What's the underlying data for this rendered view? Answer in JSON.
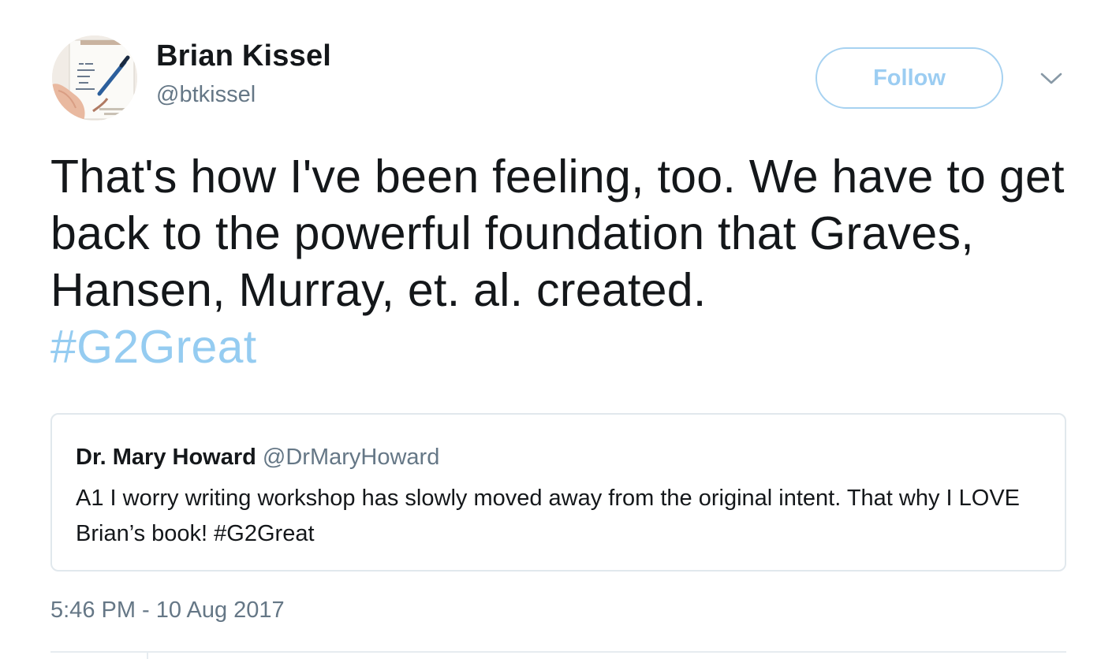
{
  "author": {
    "name": "Brian Kissel",
    "handle": "@btkissel",
    "avatar_icon": "book-cover-avatar"
  },
  "follow_button": {
    "label": "Follow",
    "color": "#9ccdf2"
  },
  "menu_icon": "chevron-down-icon",
  "tweet": {
    "text": "That's how I've been feeling, too. We have to get back to the powerful foundation that Graves, Hansen, Murray, et. al. created.",
    "hashtag": "#G2Great",
    "hashtag_color": "#95ccf1"
  },
  "quoted_tweet": {
    "name": "Dr. Mary Howard",
    "handle": "@DrMaryHoward",
    "text": "A1 I worry writing workshop has slowly moved away from the original intent. That why I LOVE Brian’s book! #G2Great"
  },
  "timestamp": "5:46 PM - 10 Aug 2017",
  "colors": {
    "text_primary": "#14171a",
    "text_secondary": "#657786",
    "border": "#e1e8ed"
  }
}
